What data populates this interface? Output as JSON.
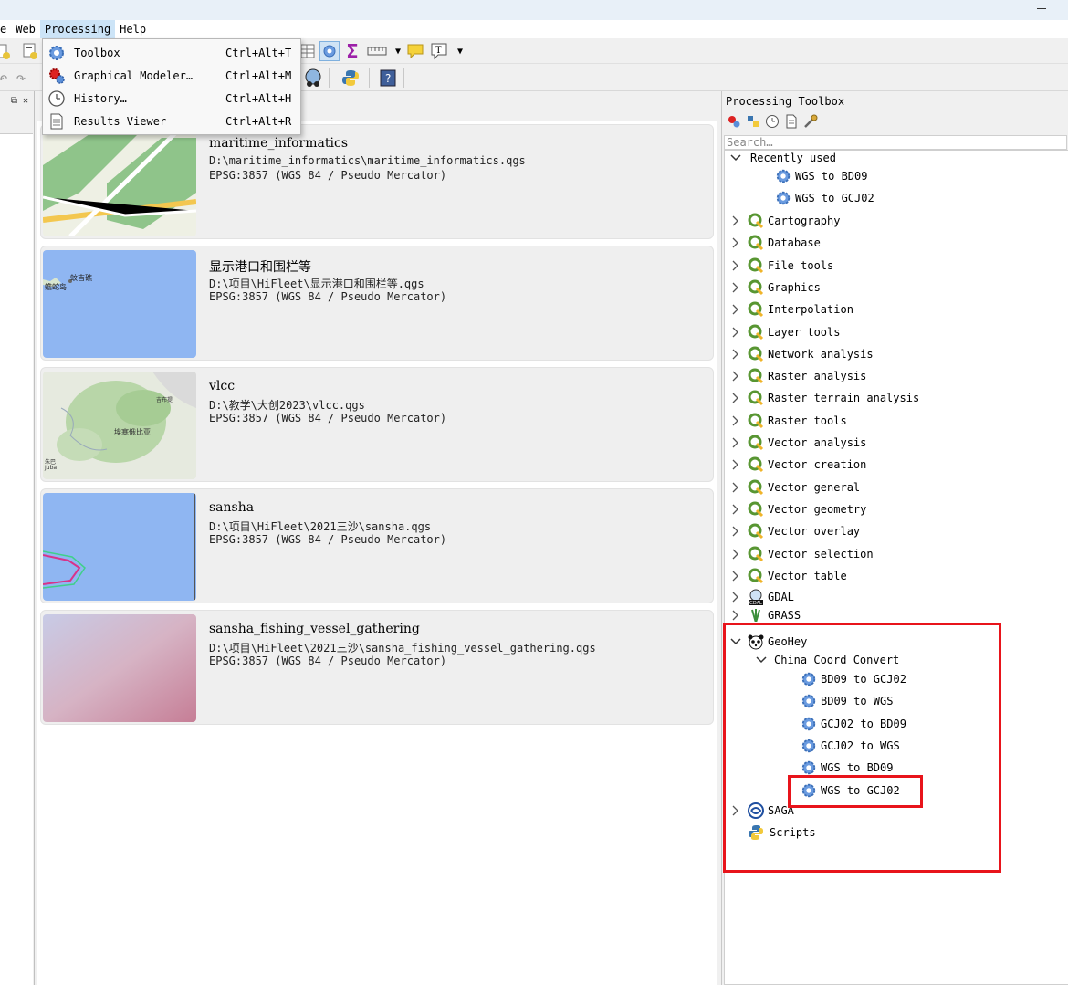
{
  "menubar": {
    "items": [
      {
        "label": "e",
        "active": false
      },
      {
        "label": "Web",
        "active": false
      },
      {
        "label": "Processing",
        "active": true
      },
      {
        "label": "Help",
        "active": false
      }
    ]
  },
  "processing_menu": {
    "items": [
      {
        "label": "Toolbox",
        "shortcut": "Ctrl+Alt+T",
        "icon": "gear-icon"
      },
      {
        "label": "Graphical Modeler…",
        "shortcut": "Ctrl+Alt+M",
        "icon": "modeler-icon"
      },
      {
        "label": "History…",
        "shortcut": "Ctrl+Alt+H",
        "icon": "clock-icon"
      },
      {
        "label": "Results Viewer",
        "shortcut": "Ctrl+Alt+R",
        "icon": "document-icon"
      }
    ]
  },
  "recent_projects": [
    {
      "name": "maritime_informatics",
      "path": "D:\\maritime_informatics\\maritime_informatics.qgs",
      "crs": "EPSG:3857 (WGS 84 / Pseudo Mercator)",
      "thumb": "map-green"
    },
    {
      "name": "显示港口和围栏等",
      "path": "D:\\项目\\HiFleet\\显示港口和围栏等.qgs",
      "crs": "EPSG:3857 (WGS 84 / Pseudo Mercator)",
      "thumb": "map-blue",
      "thumb_labels": [
        "蟾蛇岛",
        "蚊吉礁"
      ]
    },
    {
      "name": "vlcc",
      "path": "D:\\教学\\大创2023\\vlcc.qgs",
      "crs": "EPSG:3857 (WGS 84 / Pseudo Mercator)",
      "thumb": "map-terrain",
      "thumb_labels": [
        "埃塞俄比亚",
        "吉布提",
        "朱巴",
        "Juba"
      ]
    },
    {
      "name": "sansha",
      "path": "D:\\项目\\HiFleet\\2021三沙\\sansha.qgs",
      "crs": "EPSG:3857 (WGS 84 / Pseudo Mercator)",
      "thumb": "map-sea"
    },
    {
      "name": "sansha_fishing_vessel_gathering",
      "path": "D:\\项目\\HiFleet\\2021三沙\\sansha_fishing_vessel_gathering.qgs",
      "crs": "EPSG:3857 (WGS 84 / Pseudo Mercator)",
      "thumb": "map-gradient"
    }
  ],
  "toolbox": {
    "title": "Processing Toolbox",
    "search_placeholder": "Search…",
    "recently_used": {
      "label": "Recently used",
      "items": [
        "WGS to BD09",
        "WGS to GCJ02"
      ]
    },
    "providers": [
      "Cartography",
      "Database",
      "File tools",
      "Graphics",
      "Interpolation",
      "Layer tools",
      "Network analysis",
      "Raster analysis",
      "Raster terrain analysis",
      "Raster tools",
      "Vector analysis",
      "Vector creation",
      "Vector general",
      "Vector geometry",
      "Vector overlay",
      "Vector selection",
      "Vector table"
    ],
    "gdal": "GDAL",
    "grass": "GRASS",
    "geohey": {
      "label": "GeoHey",
      "group": "China Coord Convert",
      "algorithms": [
        "BD09 to GCJ02",
        "BD09 to WGS",
        "GCJ02 to BD09",
        "GCJ02 to WGS",
        "WGS to BD09",
        "WGS to GCJ02"
      ]
    },
    "saga": "SAGA",
    "scripts": "Scripts"
  },
  "colors": {
    "highlight_red": "#e8141b",
    "qgis_green": "#589632",
    "menu_active": "#cce4f7"
  }
}
